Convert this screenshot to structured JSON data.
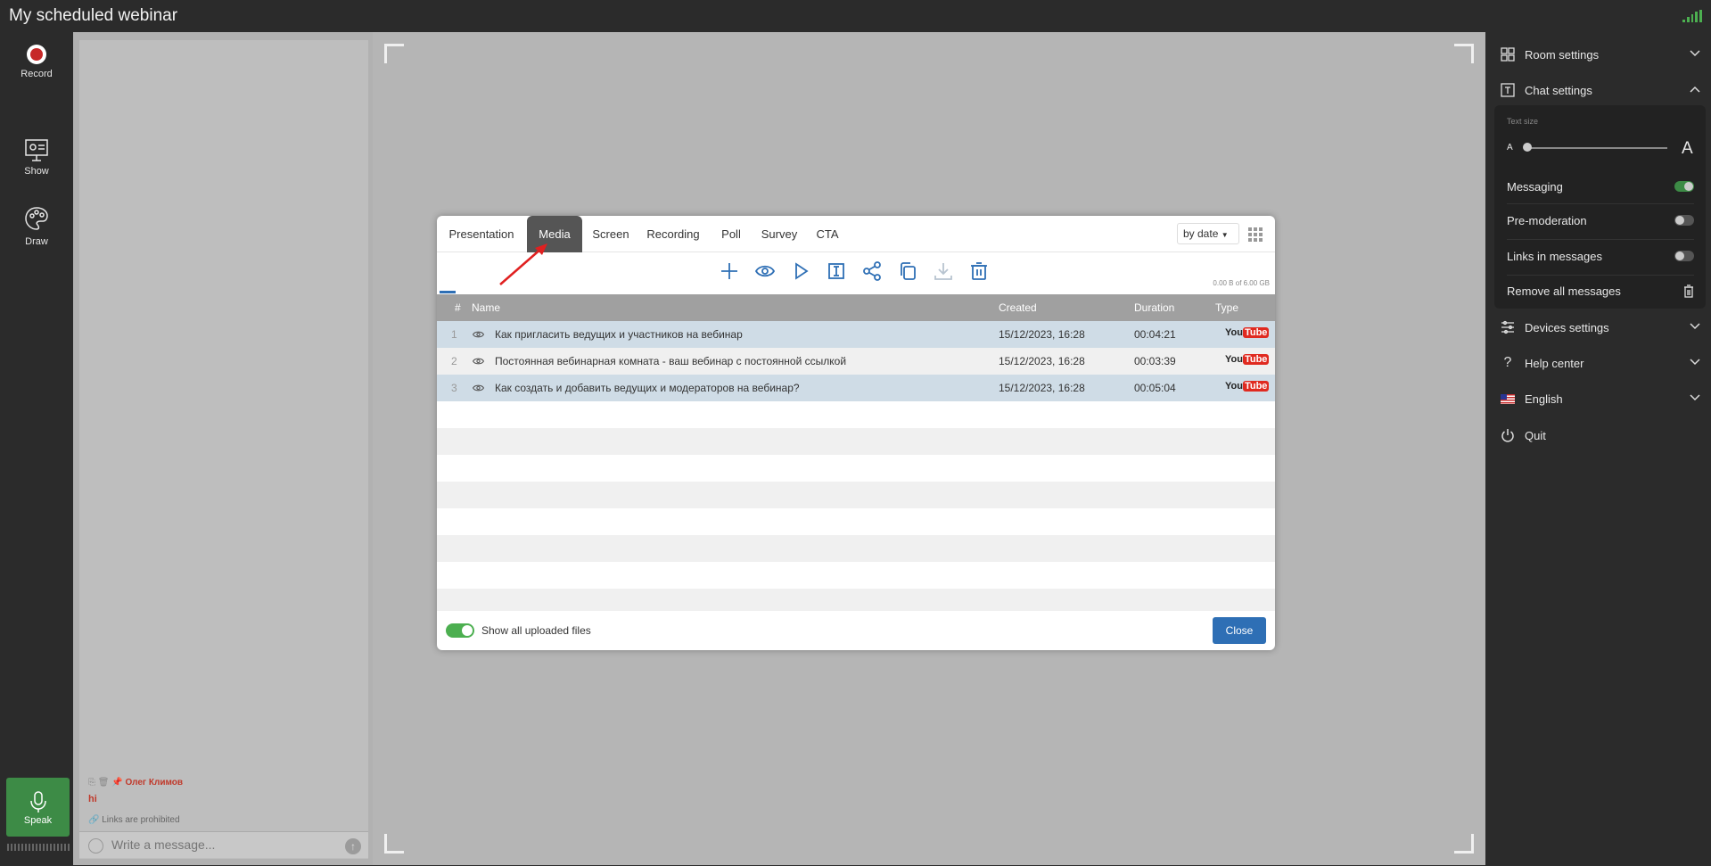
{
  "window": {
    "title": "My scheduled webinar"
  },
  "left_toolbar": {
    "record": "Record",
    "show": "Show",
    "draw": "Draw",
    "speak": "Speak"
  },
  "chat": {
    "author": "Олег Климов",
    "message": "hi",
    "links_note": "Links are prohibited",
    "input_placeholder": "Write a message..."
  },
  "right_panel": {
    "room_settings": "Room settings",
    "chat_settings": "Chat settings",
    "text_size_label": "Text size",
    "text_size_small": "A",
    "text_size_large": "A",
    "text_size_level": 0,
    "messaging": "Messaging",
    "messaging_on": true,
    "premoderation": "Pre-moderation",
    "premoderation_on": false,
    "links_in_messages": "Links in messages",
    "links_on": false,
    "remove_all": "Remove all messages",
    "devices_settings": "Devices settings",
    "help_center": "Help center",
    "language": "English",
    "quit": "Quit"
  },
  "modal": {
    "tabs": [
      "Presentation",
      "Media",
      "Screen",
      "Recording",
      "Poll",
      "Survey",
      "CTA"
    ],
    "active_tab": "Media",
    "sort": "by date",
    "storage": "0.00 B of 6.00 GB",
    "columns": {
      "num": "#",
      "name": "Name",
      "created": "Created",
      "duration": "Duration",
      "type": "Type"
    },
    "rows": [
      {
        "num": "1",
        "name": "Как пригласить ведущих и участников на вебинар",
        "created": "15/12/2023, 16:28",
        "duration": "00:04:21",
        "type": "YouTube"
      },
      {
        "num": "2",
        "name": "Постоянная вебинарная комната - ваш вебинар с постоянной ссылкой",
        "created": "15/12/2023, 16:28",
        "duration": "00:03:39",
        "type": "YouTube"
      },
      {
        "num": "3",
        "name": "Как создать и добавить ведущих и модераторов на вебинар?",
        "created": "15/12/2023, 16:28",
        "duration": "00:05:04",
        "type": "YouTube"
      }
    ],
    "show_all_label": "Show all uploaded files",
    "show_all_on": true,
    "close_label": "Close"
  },
  "youtube": {
    "you": "You",
    "tube": "Tube"
  },
  "colors": {
    "accent_blue": "#2e6fb5",
    "green": "#4caf50",
    "record_red": "#c62828",
    "chat_author": "#c0392b"
  }
}
